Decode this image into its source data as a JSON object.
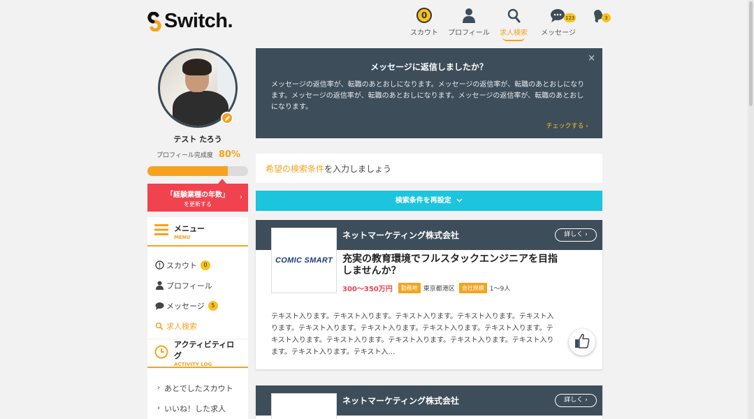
{
  "brand": {
    "logo_text": "Switch."
  },
  "topnav": [
    {
      "label": "スカウト",
      "icon": "scout-coin-icon",
      "badge": "0"
    },
    {
      "label": "プロフィール",
      "icon": "person-icon"
    },
    {
      "label": "求人検索",
      "icon": "search-icon",
      "active": true
    },
    {
      "label": "メッセージ",
      "icon": "chat-bubbles-icon",
      "badge": "123"
    },
    {
      "label": "",
      "icon": "bell-icon",
      "badge": "3"
    }
  ],
  "profile": {
    "name": "テスト たろう",
    "completion_label": "プロフィール完成度",
    "completion_value": "80%",
    "completion_fraction": 0.8,
    "update_line1": "「経験業種の年数」",
    "update_line2": "を更新する"
  },
  "menu": {
    "title": "メニュー",
    "title_en": "MENU",
    "items": [
      {
        "label": "スカウト",
        "icon": "exclamation-circle-icon",
        "badge": "0"
      },
      {
        "label": "プロフィール",
        "icon": "person-icon"
      },
      {
        "label": "メッセージ",
        "icon": "chat-icon",
        "badge": "5"
      },
      {
        "label": "求人検索",
        "icon": "search-icon",
        "active": true
      }
    ]
  },
  "activity": {
    "title": "アクティビティログ",
    "title_en": "ACTIVITY LOG",
    "items": [
      {
        "label": "あとでしたスカウト"
      },
      {
        "label": "いいね！した求人"
      }
    ]
  },
  "notice": {
    "title": "メッセージに返信しましたか？",
    "body": "メッセージの返信率が、転職のあとおしになります。メッセージの返信率が、転職のあとおしになります。メッセージの返信率が、転職のあとおしになります。メッセージの返信率が、転職のあとおしになります。",
    "check_label": "チェックする ›",
    "close": "×"
  },
  "search_conditions": {
    "link_text": "希望の検索条件",
    "suffix": "を入力しましょう",
    "reset_label": "検索条件を再設定"
  },
  "jobs": [
    {
      "company": "ネットマーケティング株式会社",
      "detail_label": "詳しく ›",
      "logo_text": "COMIC SMART",
      "title": "充実の教育環境でフルスタックエンジニアを目指しませんか？",
      "salary": "300〜350万円",
      "location_tag": "勤務地",
      "location": "東京都港区",
      "size_tag": "会社規模",
      "size": "1〜9人",
      "description": "テキスト入ります。テキスト入ります。テキスト入ります。テキスト入ります。テキスト入ります。テキスト入ります。テキスト入ります。テキスト入ります。テキスト入ります。テキスト入ります。テキスト入ります。テキスト入ります。テキスト入ります。テキスト入ります。テキスト入ります。テキスト入…"
    },
    {
      "company": "ネットマーケティング株式会社",
      "detail_label": "詳しく ›"
    }
  ]
}
